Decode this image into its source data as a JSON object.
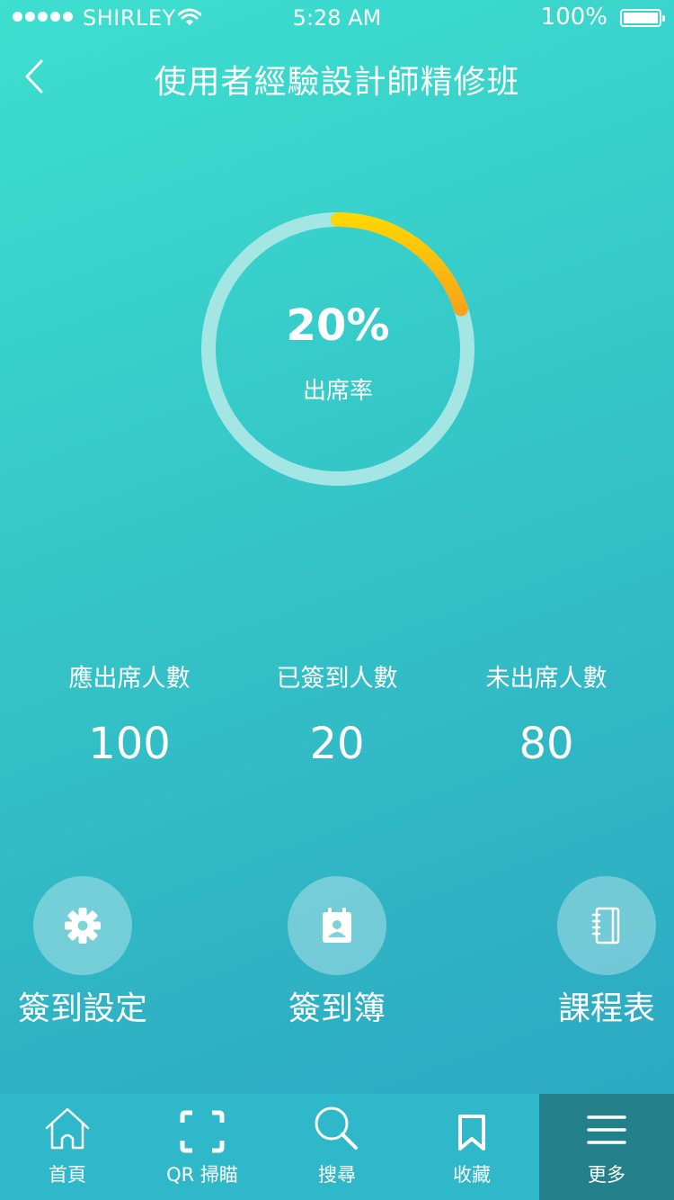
{
  "status_bar": {
    "carrier": "SHIRLEY",
    "time": "5:28 AM",
    "battery": "100%"
  },
  "header": {
    "title": "使用者經驗設計師精修班",
    "back_icon": "chevron-left-icon"
  },
  "attendance": {
    "rate_label": "出席率",
    "rate_text": "20%",
    "rate_value": 0.2,
    "ring_track_color": "#a3e6e4",
    "ring_progress_colors": [
      "#ffd500",
      "#f8a41a"
    ]
  },
  "stats": [
    {
      "label": "應出席人數",
      "value": "100"
    },
    {
      "label": "已簽到人數",
      "value": "20"
    },
    {
      "label": "未出席人數",
      "value": "80"
    }
  ],
  "actions": [
    {
      "label": "簽到設定",
      "icon": "gear-icon"
    },
    {
      "label": "簽到簿",
      "icon": "contact-calendar-icon"
    },
    {
      "label": "課程表",
      "icon": "notebook-icon"
    }
  ],
  "tabs": [
    {
      "label": "首頁",
      "icon": "home-icon",
      "active": false
    },
    {
      "label": "QR 掃瞄",
      "icon": "qr-scan-icon",
      "active": false
    },
    {
      "label": "搜尋",
      "icon": "search-icon",
      "active": false
    },
    {
      "label": "收藏",
      "icon": "bookmark-icon",
      "active": false
    },
    {
      "label": "更多",
      "icon": "menu-icon",
      "active": true
    }
  ]
}
